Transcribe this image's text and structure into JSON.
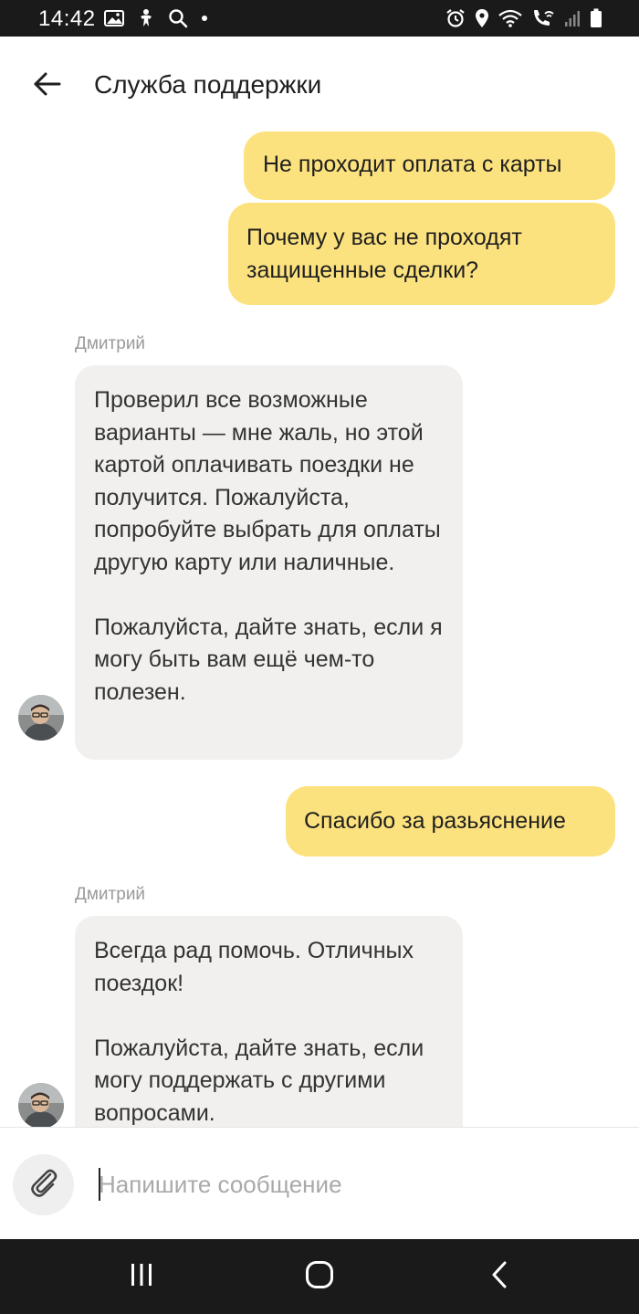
{
  "status_bar": {
    "time": "14:42",
    "left_icons": [
      "gallery-icon",
      "accessibility-icon",
      "search-icon",
      "dot-icon"
    ],
    "right_icons": [
      "alarm-icon",
      "location-icon",
      "wifi-icon",
      "wifi-call-icon",
      "signal-icon",
      "battery-icon"
    ]
  },
  "header": {
    "back_icon": "arrow-left-icon",
    "title": "Служба поддержки"
  },
  "chat": {
    "messages": [
      {
        "from": "user",
        "text": "Не проходит оплата с карты"
      },
      {
        "from": "user",
        "text": "Почему у вас не проходят защищенные сделки?"
      },
      {
        "from": "operator",
        "sender": "Дмитрий",
        "text": "Проверил все возможные варианты — мне жаль, но этой картой оплачивать поездки не получится. Пожалуйста, попробуйте выбрать для оплаты другую карту или наличные.\n\nПожалуйста, дайте знать, если я могу быть вам ещё чем-то полезен."
      },
      {
        "from": "user",
        "text": "Спасибо за разьяснение"
      },
      {
        "from": "operator",
        "sender": "Дмитрий",
        "text": "Всегда рад помочь. Отличных поездок!\n\nПожалуйста, дайте знать, если могу поддержать с другими вопросами."
      }
    ]
  },
  "composer": {
    "attach_icon": "paperclip-icon",
    "placeholder": "Напишите сообщение",
    "value": ""
  },
  "nav_bar": {
    "icons": [
      "recent-apps-icon",
      "home-icon",
      "back-icon"
    ]
  },
  "colors": {
    "user_bubble": "#fce27e",
    "operator_bubble": "#f1f0ee",
    "system_bars": "#1a1a1a",
    "sender_name": "#9a9a9a"
  }
}
